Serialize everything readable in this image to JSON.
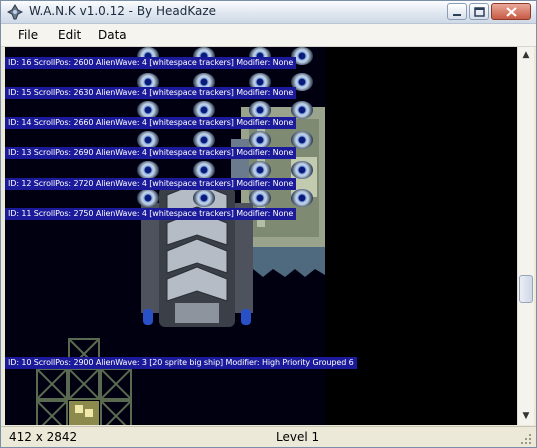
{
  "window": {
    "title": "W.A.N.K v1.0.12 - By HeadKaze",
    "icons": {
      "app": "app-ship-icon",
      "minimize": "minimize-icon",
      "maximize": "maximize-icon",
      "close": "close-icon"
    }
  },
  "menu": {
    "items": [
      "File",
      "Edit",
      "Data"
    ]
  },
  "canvas": {
    "wave_labels": [
      "ID: 16 ScrollPos: 2600 AlienWave: 4 [whitespace trackers] Modifier: None",
      "ID: 15 ScrollPos: 2630 AlienWave: 4 [whitespace trackers] Modifier: None",
      "ID: 14 ScrollPos: 2660 AlienWave: 4 [whitespace trackers] Modifier: None",
      "ID: 13 ScrollPos: 2690 AlienWave: 4 [whitespace trackers] Modifier: None",
      "ID: 12 ScrollPos: 2720 AlienWave: 4 [whitespace trackers] Modifier: None",
      "ID: 11 ScrollPos: 2750 AlienWave: 4 [whitespace trackers] Modifier: None",
      "ID: 10 ScrollPos: 2900 AlienWave: 3 [20 sprite big ship] Modifier: High Priority Grouped 6"
    ]
  },
  "scrollbar": {
    "up": "▲",
    "down": "▼"
  },
  "status": {
    "size": "412 x 2842",
    "level": "Level 1"
  },
  "colors": {
    "label_bg": "#1a1a9a",
    "canvas_bg": "#000010"
  }
}
